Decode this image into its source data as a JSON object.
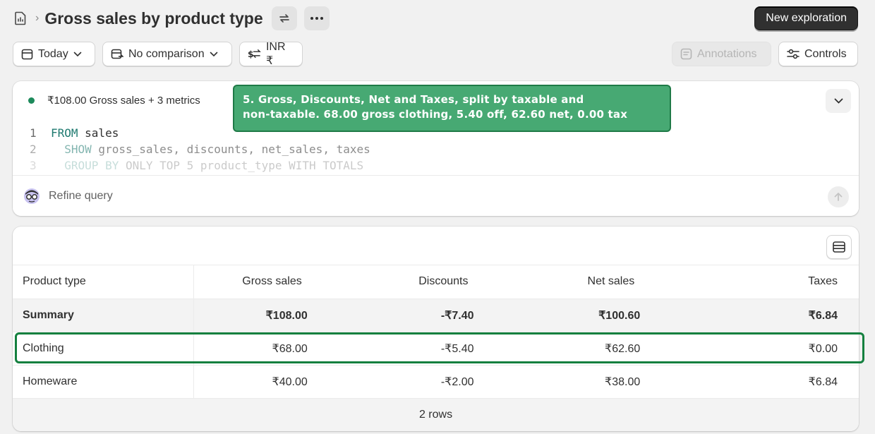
{
  "header": {
    "title": "Gross sales by product type",
    "new_button": "New exploration"
  },
  "toolbar": {
    "date_label": "Today",
    "comparison_label": "No comparison",
    "currency_label": "INR ₹",
    "annotations_label": "Annotations",
    "controls_label": "Controls"
  },
  "query": {
    "metrics_summary": "₹108.00 Gross sales + 3 metrics",
    "lines": [
      {
        "num": "1",
        "kw": "FROM",
        "rest": " sales",
        "indent": ""
      },
      {
        "num": "2",
        "kw": "SHOW",
        "rest": " gross_sales, discounts, net_sales, taxes",
        "indent": "  "
      },
      {
        "num": "3",
        "kw": "GROUP BY",
        "rest": " ONLY TOP 5 product_type WITH TOTALS",
        "indent": "  "
      }
    ],
    "refine_placeholder": "Refine query"
  },
  "callout": {
    "text_line1": "5. Gross, Discounts, Net and Taxes, split by taxable and",
    "text_line2": "non-taxable. 68.00 gross clothing, 5.40 off, 62.60 net, 0.00 tax"
  },
  "table": {
    "columns": [
      "Product type",
      "Gross sales",
      "Discounts",
      "Net sales",
      "Taxes"
    ],
    "summary": [
      "Summary",
      "₹108.00",
      "-₹7.40",
      "₹100.60",
      "₹6.84"
    ],
    "rows": [
      [
        "Clothing",
        "₹68.00",
        "-₹5.40",
        "₹62.60",
        "₹0.00"
      ],
      [
        "Homeware",
        "₹40.00",
        "-₹2.00",
        "₹38.00",
        "₹6.84"
      ]
    ],
    "footer": "2 rows"
  },
  "colors": {
    "accent_green": "#1d8a5b",
    "callout_bg": "#47a973",
    "highlight_border": "#14803f",
    "primary_button": "#303030"
  }
}
